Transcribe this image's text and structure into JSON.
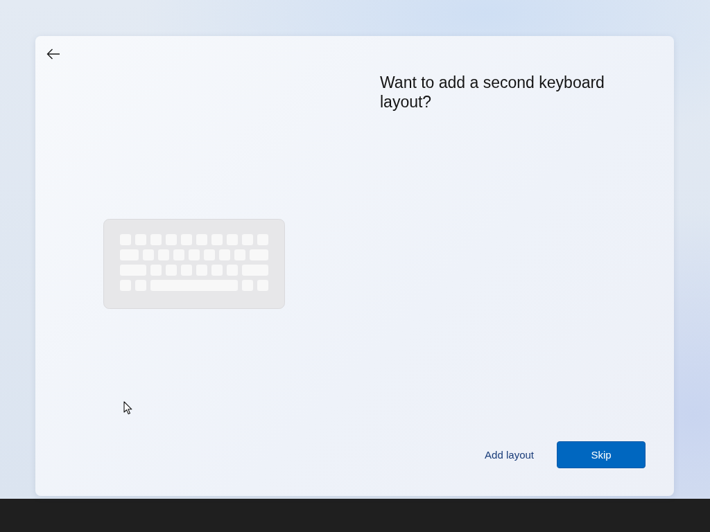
{
  "dialog": {
    "title": "Want to add a second keyboard layout?"
  },
  "buttons": [
    {
      "label": "Add layout",
      "kind": "text"
    },
    {
      "label": "Skip",
      "kind": "primary"
    }
  ]
}
